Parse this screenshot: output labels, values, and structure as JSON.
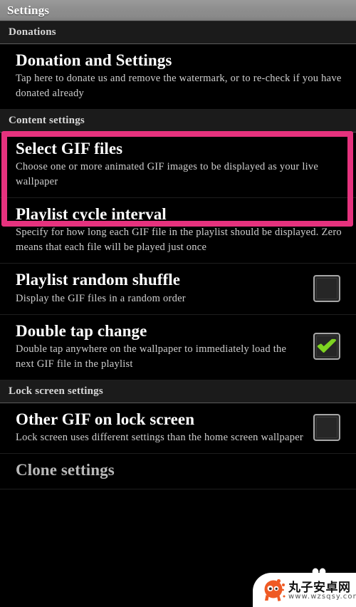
{
  "window": {
    "title": "Settings"
  },
  "colors": {
    "highlight_pink": "#e6327e",
    "checkbox_check_green": "#7ed321",
    "titlebar_gray": "#8e8e8e",
    "background": "#000000",
    "section_header_bg": "#1b1b1b"
  },
  "sections": [
    {
      "header": "Donations",
      "items": [
        {
          "title": "Donation and Settings",
          "summary": "Tap here to donate us and remove the watermark, or to re-check if you have donated already",
          "control": "none"
        }
      ]
    },
    {
      "header": "Content settings",
      "items": [
        {
          "title": "Select GIF files",
          "summary": "Choose one or more animated GIF images to be displayed as your live wallpaper",
          "control": "none",
          "highlighted": true
        },
        {
          "title": "Playlist cycle interval",
          "summary": "Specify for how long each GIF file in the playlist should be displayed. Zero means that each file will be played just once",
          "control": "none"
        },
        {
          "title": "Playlist random shuffle",
          "summary": "Display the GIF files in a random order",
          "control": "checkbox",
          "checked": false
        },
        {
          "title": "Double tap change",
          "summary": "Double tap anywhere on the wallpaper to immediately load the next GIF file in the playlist",
          "control": "checkbox",
          "checked": true
        }
      ]
    },
    {
      "header": "Lock screen settings",
      "items": [
        {
          "title": "Other GIF on lock screen",
          "summary": "Lock screen uses different settings than the home screen wallpaper",
          "control": "checkbox",
          "checked": false
        },
        {
          "title": "Clone settings",
          "summary": "",
          "control": "none"
        }
      ]
    }
  ],
  "watermark": {
    "site_name": "丸子安卓网",
    "url": "www.wzsqsy.com",
    "mascot_color": "#ef5a24"
  }
}
